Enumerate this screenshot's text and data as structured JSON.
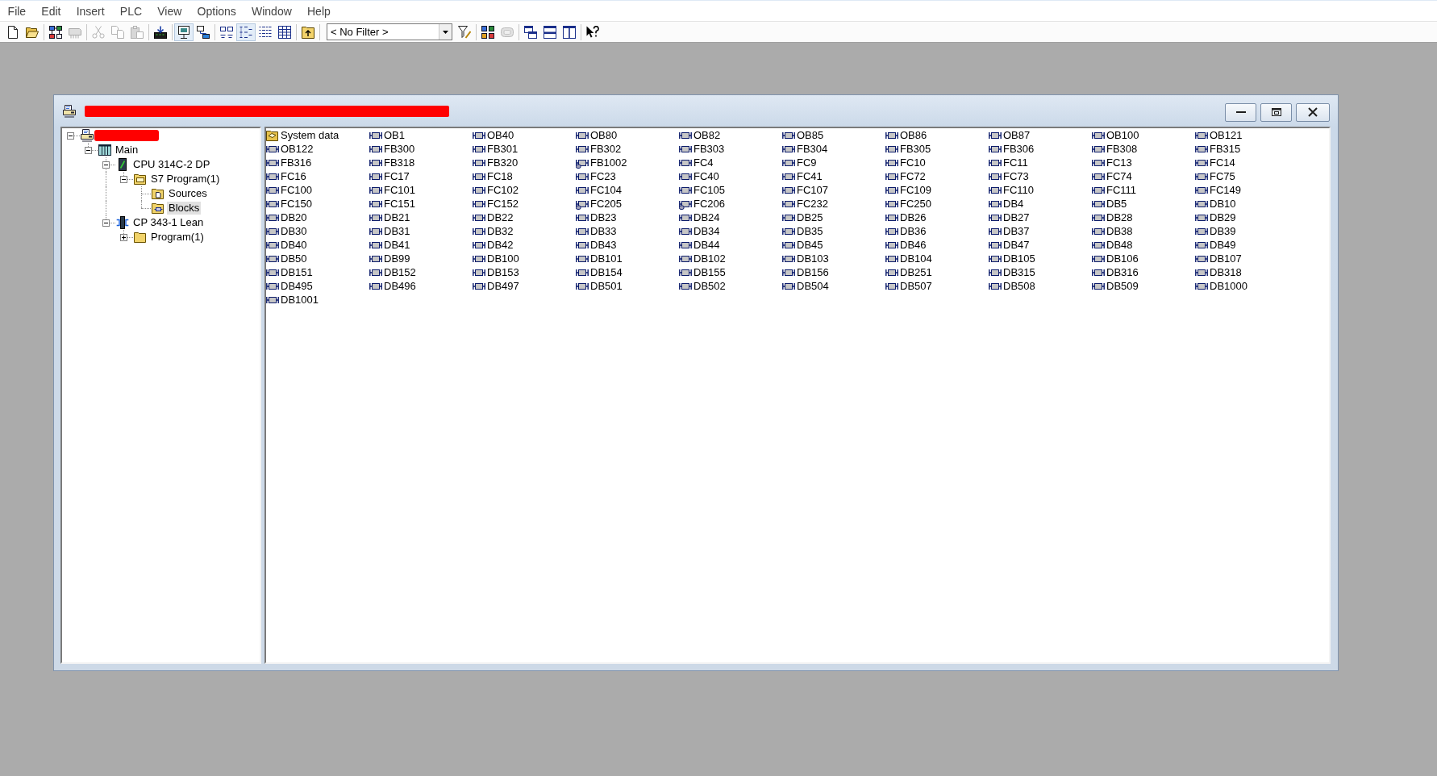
{
  "menu": [
    "File",
    "Edit",
    "Insert",
    "PLC",
    "View",
    "Options",
    "Window",
    "Help"
  ],
  "toolbar": [
    {
      "kind": "button",
      "disabled": false,
      "pressed": false
    },
    {
      "kind": "button",
      "disabled": false,
      "pressed": false
    },
    {
      "kind": "separator"
    },
    {
      "kind": "button",
      "disabled": false,
      "pressed": false
    },
    {
      "kind": "button",
      "disabled": true,
      "pressed": false
    },
    {
      "kind": "separator"
    },
    {
      "kind": "button",
      "disabled": true,
      "pressed": false
    },
    {
      "kind": "button",
      "disabled": true,
      "pressed": false
    },
    {
      "kind": "button",
      "disabled": true,
      "pressed": false
    },
    {
      "kind": "separator"
    },
    {
      "kind": "button",
      "disabled": false,
      "pressed": false
    },
    {
      "kind": "separator"
    },
    {
      "kind": "button",
      "disabled": false,
      "pressed": true
    },
    {
      "kind": "button",
      "disabled": false,
      "pressed": false
    },
    {
      "kind": "separator"
    },
    {
      "kind": "button",
      "disabled": false,
      "pressed": false
    },
    {
      "kind": "button",
      "disabled": false,
      "pressed": true
    },
    {
      "kind": "button",
      "disabled": false,
      "pressed": false
    },
    {
      "kind": "button",
      "disabled": false,
      "pressed": false
    },
    {
      "kind": "separator"
    },
    {
      "kind": "button",
      "disabled": false,
      "pressed": false
    },
    {
      "kind": "separator"
    },
    {
      "kind": "combo",
      "value": "< No Filter >"
    },
    {
      "kind": "button",
      "disabled": false,
      "pressed": false
    },
    {
      "kind": "separator"
    },
    {
      "kind": "button",
      "disabled": false,
      "pressed": false
    },
    {
      "kind": "button",
      "disabled": true,
      "pressed": false
    },
    {
      "kind": "separator"
    },
    {
      "kind": "button",
      "disabled": false,
      "pressed": false
    },
    {
      "kind": "button",
      "disabled": false,
      "pressed": false
    },
    {
      "kind": "button",
      "disabled": false,
      "pressed": false
    },
    {
      "kind": "separator"
    },
    {
      "kind": "button",
      "disabled": false,
      "pressed": false
    }
  ],
  "window": {
    "title": {
      "redacted": true
    }
  },
  "tree": [
    {
      "kind": "project",
      "redacted": true,
      "expanded": true,
      "selected": false,
      "children": [
        {
          "kind": "station",
          "label": "Main",
          "expanded": true,
          "selected": false,
          "children": [
            {
              "kind": "cpu",
              "label": "CPU 314C-2 DP",
              "expanded": true,
              "selected": false,
              "children": [
                {
                  "kind": "program",
                  "label": "S7 Program(1)",
                  "expanded": true,
                  "selected": false,
                  "children": [
                    {
                      "kind": "sources",
                      "label": "Sources",
                      "selected": false
                    },
                    {
                      "kind": "blocks",
                      "label": "Blocks",
                      "selected": true
                    }
                  ]
                }
              ]
            },
            {
              "kind": "cp",
              "label": "CP 343-1 Lean",
              "expanded": true,
              "selected": false,
              "children": [
                {
                  "kind": "folder",
                  "label": "Program(1)",
                  "expanded": false,
                  "selected": false
                }
              ]
            }
          ]
        }
      ]
    }
  ],
  "list": {
    "items": [
      {
        "name": "System data",
        "kind": "folder",
        "selected": false
      },
      {
        "name": "OB1",
        "kind": "block",
        "selected": false
      },
      {
        "name": "OB40",
        "kind": "block",
        "selected": false
      },
      {
        "name": "OB80",
        "kind": "block",
        "selected": false
      },
      {
        "name": "OB82",
        "kind": "block",
        "selected": false
      },
      {
        "name": "OB85",
        "kind": "block",
        "selected": false
      },
      {
        "name": "OB86",
        "kind": "block",
        "selected": false
      },
      {
        "name": "OB87",
        "kind": "block",
        "selected": false
      },
      {
        "name": "OB100",
        "kind": "block",
        "selected": false
      },
      {
        "name": "OB121",
        "kind": "block",
        "selected": false
      },
      {
        "name": "OB122",
        "kind": "block",
        "selected": false
      },
      {
        "name": "FB300",
        "kind": "block",
        "selected": false
      },
      {
        "name": "FB301",
        "kind": "block",
        "selected": false
      },
      {
        "name": "FB302",
        "kind": "block",
        "selected": false
      },
      {
        "name": "FB303",
        "kind": "block",
        "selected": false
      },
      {
        "name": "FB304",
        "kind": "block",
        "selected": false
      },
      {
        "name": "FB305",
        "kind": "block",
        "selected": false
      },
      {
        "name": "FB306",
        "kind": "block",
        "selected": false
      },
      {
        "name": "FB308",
        "kind": "block",
        "selected": false
      },
      {
        "name": "FB315",
        "kind": "block",
        "selected": false
      },
      {
        "name": "FB316",
        "kind": "block",
        "selected": false
      },
      {
        "name": "FB318",
        "kind": "block",
        "selected": false
      },
      {
        "name": "FB320",
        "kind": "block",
        "selected": false
      },
      {
        "name": "FB1002",
        "kind": "badged",
        "selected": false
      },
      {
        "name": "FC4",
        "kind": "block",
        "selected": false
      },
      {
        "name": "FC9",
        "kind": "block",
        "selected": false
      },
      {
        "name": "FC10",
        "kind": "block",
        "selected": false
      },
      {
        "name": "FC11",
        "kind": "block",
        "selected": false
      },
      {
        "name": "FC13",
        "kind": "block",
        "selected": false
      },
      {
        "name": "FC14",
        "kind": "block",
        "selected": false
      },
      {
        "name": "FC16",
        "kind": "block",
        "selected": false
      },
      {
        "name": "FC17",
        "kind": "block",
        "selected": false
      },
      {
        "name": "FC18",
        "kind": "block",
        "selected": false
      },
      {
        "name": "FC23",
        "kind": "block",
        "selected": false
      },
      {
        "name": "FC40",
        "kind": "block",
        "selected": false
      },
      {
        "name": "FC41",
        "kind": "block",
        "selected": false
      },
      {
        "name": "FC72",
        "kind": "block",
        "selected": false
      },
      {
        "name": "FC73",
        "kind": "block",
        "selected": false
      },
      {
        "name": "FC74",
        "kind": "block",
        "selected": false
      },
      {
        "name": "FC75",
        "kind": "block",
        "selected": false
      },
      {
        "name": "FC100",
        "kind": "block",
        "selected": false
      },
      {
        "name": "FC101",
        "kind": "block",
        "selected": false
      },
      {
        "name": "FC102",
        "kind": "block",
        "selected": false
      },
      {
        "name": "FC104",
        "kind": "block",
        "selected": false
      },
      {
        "name": "FC105",
        "kind": "block",
        "selected": false
      },
      {
        "name": "FC107",
        "kind": "block",
        "selected": false
      },
      {
        "name": "FC109",
        "kind": "block",
        "selected": false
      },
      {
        "name": "FC110",
        "kind": "block",
        "selected": false
      },
      {
        "name": "FC111",
        "kind": "block",
        "selected": false
      },
      {
        "name": "FC149",
        "kind": "block",
        "selected": false
      },
      {
        "name": "FC150",
        "kind": "block",
        "selected": false
      },
      {
        "name": "FC151",
        "kind": "block",
        "selected": false
      },
      {
        "name": "FC152",
        "kind": "block",
        "selected": false
      },
      {
        "name": "FC205",
        "kind": "badged",
        "selected": false
      },
      {
        "name": "FC206",
        "kind": "badged",
        "selected": false
      },
      {
        "name": "FC232",
        "kind": "block",
        "selected": false
      },
      {
        "name": "FC250",
        "kind": "block",
        "selected": false
      },
      {
        "name": "DB4",
        "kind": "block",
        "selected": false
      },
      {
        "name": "DB5",
        "kind": "block",
        "selected": false
      },
      {
        "name": "DB10",
        "kind": "block",
        "selected": false
      },
      {
        "name": "DB20",
        "kind": "block",
        "selected": false
      },
      {
        "name": "DB21",
        "kind": "block",
        "selected": false
      },
      {
        "name": "DB22",
        "kind": "block",
        "selected": false
      },
      {
        "name": "DB23",
        "kind": "block",
        "selected": false
      },
      {
        "name": "DB24",
        "kind": "block",
        "selected": false
      },
      {
        "name": "DB25",
        "kind": "block",
        "selected": false
      },
      {
        "name": "DB26",
        "kind": "block",
        "selected": false
      },
      {
        "name": "DB27",
        "kind": "block",
        "selected": false
      },
      {
        "name": "DB28",
        "kind": "block",
        "selected": false
      },
      {
        "name": "DB29",
        "kind": "block",
        "selected": false
      },
      {
        "name": "DB30",
        "kind": "block",
        "selected": false
      },
      {
        "name": "DB31",
        "kind": "block",
        "selected": false
      },
      {
        "name": "DB32",
        "kind": "block",
        "selected": false
      },
      {
        "name": "DB33",
        "kind": "block",
        "selected": false
      },
      {
        "name": "DB34",
        "kind": "block",
        "selected": false
      },
      {
        "name": "DB35",
        "kind": "block",
        "selected": false
      },
      {
        "name": "DB36",
        "kind": "block",
        "selected": false
      },
      {
        "name": "DB37",
        "kind": "block",
        "selected": false
      },
      {
        "name": "DB38",
        "kind": "block",
        "selected": false
      },
      {
        "name": "DB39",
        "kind": "block",
        "selected": false
      },
      {
        "name": "DB40",
        "kind": "block",
        "selected": false
      },
      {
        "name": "DB41",
        "kind": "block",
        "selected": false
      },
      {
        "name": "DB42",
        "kind": "block",
        "selected": false
      },
      {
        "name": "DB43",
        "kind": "block",
        "selected": false
      },
      {
        "name": "DB44",
        "kind": "block",
        "selected": false
      },
      {
        "name": "DB45",
        "kind": "block",
        "selected": false
      },
      {
        "name": "DB46",
        "kind": "block",
        "selected": false
      },
      {
        "name": "DB47",
        "kind": "block",
        "selected": false
      },
      {
        "name": "DB48",
        "kind": "block",
        "selected": false
      },
      {
        "name": "DB49",
        "kind": "block",
        "selected": false
      },
      {
        "name": "DB50",
        "kind": "block",
        "selected": false
      },
      {
        "name": "DB99",
        "kind": "block",
        "selected": false
      },
      {
        "name": "DB100",
        "kind": "block",
        "selected": false
      },
      {
        "name": "DB101",
        "kind": "block",
        "selected": false
      },
      {
        "name": "DB102",
        "kind": "block",
        "selected": false
      },
      {
        "name": "DB103",
        "kind": "block",
        "selected": false
      },
      {
        "name": "DB104",
        "kind": "block",
        "selected": false
      },
      {
        "name": "DB105",
        "kind": "block",
        "selected": false
      },
      {
        "name": "DB106",
        "kind": "block",
        "selected": false
      },
      {
        "name": "DB107",
        "kind": "block",
        "selected": false
      },
      {
        "name": "DB151",
        "kind": "block",
        "selected": false
      },
      {
        "name": "DB152",
        "kind": "block",
        "selected": false
      },
      {
        "name": "DB153",
        "kind": "block",
        "selected": false
      },
      {
        "name": "DB154",
        "kind": "block",
        "selected": false
      },
      {
        "name": "DB155",
        "kind": "block",
        "selected": false
      },
      {
        "name": "DB156",
        "kind": "block",
        "selected": false
      },
      {
        "name": "DB251",
        "kind": "block",
        "selected": false
      },
      {
        "name": "DB315",
        "kind": "block",
        "selected": false
      },
      {
        "name": "DB316",
        "kind": "block",
        "selected": false
      },
      {
        "name": "DB318",
        "kind": "block",
        "selected": false
      },
      {
        "name": "DB495",
        "kind": "block",
        "selected": false
      },
      {
        "name": "DB496",
        "kind": "block",
        "selected": false
      },
      {
        "name": "DB497",
        "kind": "block",
        "selected": false
      },
      {
        "name": "DB501",
        "kind": "block",
        "selected": false
      },
      {
        "name": "DB502",
        "kind": "block",
        "selected": false
      },
      {
        "name": "DB504",
        "kind": "block",
        "selected": false
      },
      {
        "name": "DB507",
        "kind": "block",
        "selected": false
      },
      {
        "name": "DB508",
        "kind": "block",
        "selected": false
      },
      {
        "name": "DB509",
        "kind": "block",
        "selected": false
      },
      {
        "name": "DB1000",
        "kind": "block",
        "selected": false
      },
      {
        "name": "DB1001",
        "kind": "block",
        "selected": false
      }
    ]
  }
}
